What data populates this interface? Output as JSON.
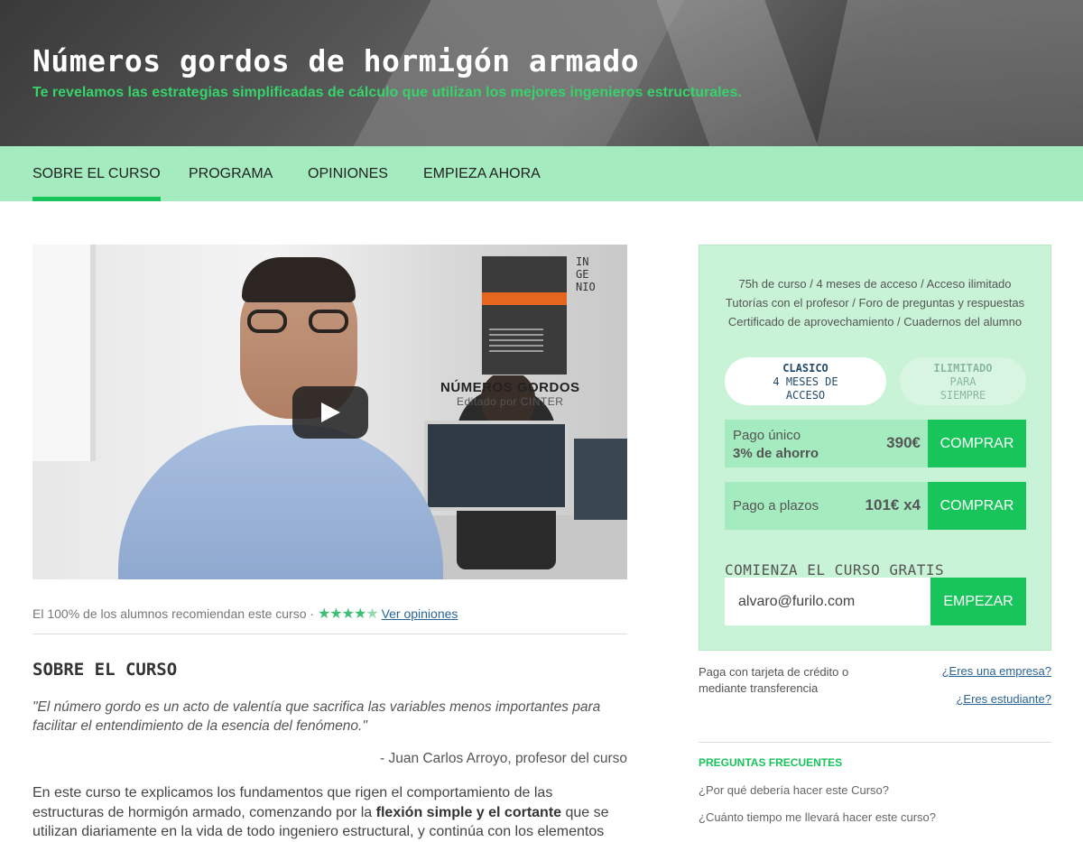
{
  "hero": {
    "title": "Números gordos de hormigón armado",
    "subtitle": "Te revelamos las estrategias simplificadas de cálculo que utilizan los mejores ingenieros estructurales."
  },
  "nav": {
    "items": [
      {
        "label": "SOBRE EL CURSO",
        "active": true
      },
      {
        "label": "PROGRAMA",
        "active": false
      },
      {
        "label": "OPINIONES",
        "active": false
      },
      {
        "label": "EMPIEZA AHORA",
        "active": false
      }
    ]
  },
  "video": {
    "book_title": "NÚMEROS GORDOS",
    "book_subtitle": "Editado por CINTER",
    "logo_lines": [
      "IN",
      "GE",
      "NIO"
    ]
  },
  "recommend": {
    "text": "El 100% de los alumnos recomiendan este curso ·",
    "rating_stars": 4.5,
    "link": "Ver opiniones"
  },
  "about": {
    "title": "SOBRE EL CURSO",
    "quote": "\"El número gordo es un acto de valentía que sacrifica las variables menos importantes para facilitar el entendimiento de la esencia del fenómeno.\"",
    "quote_author": "- Juan Carlos Arroyo, profesor del curso",
    "body_1": "En este curso te explicamos los fundamentos que rigen el comportamiento de las estructuras de hormigón armado, comenzando por la ",
    "body_bold": "flexión simple y el cortante",
    "body_2": " que se utilizan diariamente en la vida de todo ingeniero estructural, y continúa con los elementos"
  },
  "sidebar": {
    "features": [
      "75h de curso / 4 meses de acceso / Acceso ilimitado",
      "Tutorías con el profesor / Foro de preguntas y respuestas",
      "Certificado de aprovechamiento / Cuadernos del alumno"
    ],
    "plans": [
      {
        "name": "CLASICO",
        "line1": "4 MESES DE",
        "line2": "ACCESO",
        "selected": true
      },
      {
        "name": "ILIMITADO",
        "line1": "PARA",
        "line2": "SIEMPRE",
        "selected": false
      }
    ],
    "pricing": [
      {
        "label": "Pago único",
        "sublabel": "3% de ahorro",
        "price": "390€",
        "button": "COMPRAR"
      },
      {
        "label": "Pago a plazos",
        "sublabel": "",
        "price": "101€ x4",
        "button": "COMPRAR"
      }
    ],
    "free": {
      "title": "COMIENZA EL CURSO GRATIS",
      "email_value": "alvaro@furilo.com",
      "button": "EMPEZAR"
    },
    "payment_note": "Paga con tarjeta de crédito o mediante transferencia",
    "enterprise_link": "¿Eres una empresa?",
    "student_link": "¿Eres estudiante?",
    "faq_title": "PREGUNTAS FRECUENTES",
    "faq": [
      "¿Por qué debería hacer este Curso?",
      "¿Cuánto tiempo me llevará hacer este curso?"
    ]
  },
  "colors": {
    "accent": "#17c55b",
    "nav_bg": "#a4ecbf",
    "card_bg": "#c9f3d7",
    "subtitle": "#36d36a"
  }
}
